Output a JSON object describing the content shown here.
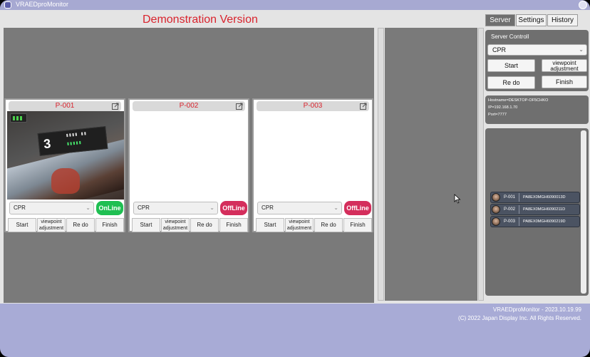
{
  "window": {
    "title": "VRAEDproMonitor"
  },
  "header": {
    "demo_label": "Demonstration Version"
  },
  "cards": [
    {
      "id": "P-001",
      "mode": "CPR",
      "status": "OnLine",
      "start": "Start",
      "viewpoint_line1": "viewpoint",
      "viewpoint_line2": "adjustment",
      "redo": "Re do",
      "finish": "Finish",
      "hud_count": "3"
    },
    {
      "id": "P-002",
      "mode": "CPR",
      "status": "OffLine",
      "start": "Start",
      "viewpoint_line1": "viewpoint",
      "viewpoint_line2": "adjustment",
      "redo": "Re do",
      "finish": "Finish"
    },
    {
      "id": "P-003",
      "mode": "CPR",
      "status": "OffLine",
      "start": "Start",
      "viewpoint_line1": "viewpoint",
      "viewpoint_line2": "adjustment",
      "redo": "Re do",
      "finish": "Finish"
    }
  ],
  "tabs": [
    "Server",
    "Settings",
    "History"
  ],
  "server": {
    "section_label": "Server Controll",
    "mode": "CPR",
    "start": "Start",
    "viewpoint_line1": "viewpoint",
    "viewpoint_line2": "adjustment",
    "redo": "Re do",
    "finish": "Finish",
    "hostname": "Hostname=DESKTOP-OF5CHKO",
    "ip": "IP=192.168.1.70",
    "port": "Port=7777"
  },
  "devices": [
    {
      "id": "P-001",
      "serial": "PA8EX0MGH6090013D"
    },
    {
      "id": "P-002",
      "serial": "PA8EX0MGH6090211D"
    },
    {
      "id": "P-003",
      "serial": "PA8EX0MGH6090219D"
    }
  ],
  "footer": {
    "version": "VRAEDproMonitor - 2023.10.19.99",
    "copyright": "(C) 2022 Japan Display Inc. All Rights Reserved."
  },
  "colors": {
    "demo_red": "#d9232d",
    "online_green": "#1fbf52",
    "offline_red": "#d42e5c",
    "frame_lavender": "#a8abd6"
  }
}
